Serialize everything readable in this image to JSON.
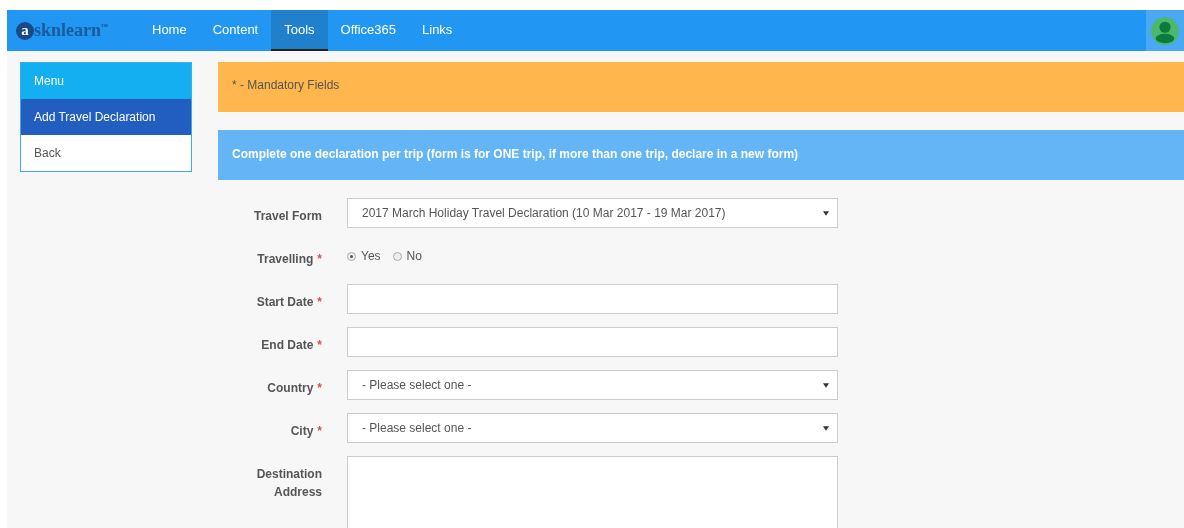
{
  "navbar": {
    "logo": {
      "badge": "a",
      "text": "sknlearn",
      "mark": "™"
    },
    "items": [
      {
        "label": "Home",
        "selected": false
      },
      {
        "label": "Content",
        "selected": false
      },
      {
        "label": "Tools",
        "selected": true
      },
      {
        "label": "Office365",
        "selected": false
      },
      {
        "label": "Links",
        "selected": false
      }
    ]
  },
  "sidebar": {
    "title": "Menu",
    "items": [
      {
        "label": "Add Travel Declaration",
        "selected": true
      },
      {
        "label": "Back",
        "selected": false
      }
    ]
  },
  "notice": "* - Mandatory Fields",
  "instruction": "Complete one declaration per trip (form is for ONE trip, if more than one trip, declare in a new form)",
  "form": [
    {
      "kind": "select",
      "label": "Travel Form",
      "value": "2017 March Holiday Travel Declaration (10 Mar 2017 - 19 Mar 2017)"
    },
    {
      "kind": "radio",
      "label": "Travelling",
      "required_mark": "*",
      "options": [
        {
          "label": "Yes",
          "selected": true
        },
        {
          "label": "No",
          "selected": false
        }
      ]
    },
    {
      "kind": "text",
      "label": "Start Date",
      "required_mark": "*"
    },
    {
      "kind": "text",
      "label": "End Date",
      "required_mark": "*"
    },
    {
      "kind": "select",
      "label": "Country",
      "required_mark": "*",
      "value": "- Please select one -"
    },
    {
      "kind": "select",
      "label": "City",
      "required_mark": "*",
      "value": "- Please select one -"
    },
    {
      "kind": "textarea",
      "label": "Destination Address"
    }
  ]
}
